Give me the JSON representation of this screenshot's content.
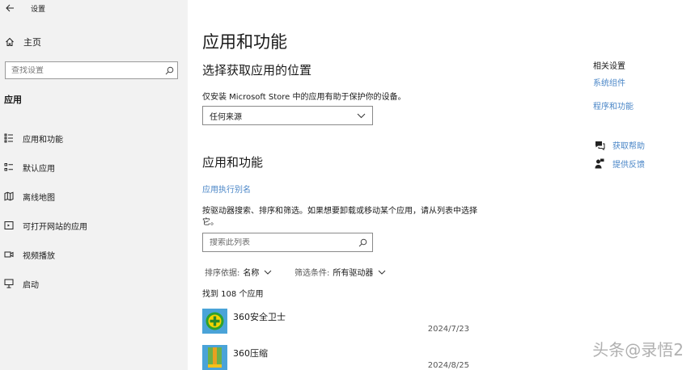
{
  "window": {
    "title": "设置"
  },
  "sidebar": {
    "home_label": "主页",
    "search_placeholder": "查找设置",
    "section_title": "应用",
    "items": [
      {
        "label": "应用和功能",
        "icon": "apps-list-icon"
      },
      {
        "label": "默认应用",
        "icon": "default-apps-icon"
      },
      {
        "label": "离线地图",
        "icon": "offline-map-icon"
      },
      {
        "label": "可打开网站的应用",
        "icon": "web-apps-icon"
      },
      {
        "label": "视频播放",
        "icon": "video-icon"
      },
      {
        "label": "启动",
        "icon": "startup-icon"
      }
    ]
  },
  "main": {
    "title": "应用和功能",
    "choose_heading": "选择获取应用的位置",
    "choose_desc": "仅安装 Microsoft Store 中的应用有助于保护你的设备。",
    "source_dropdown": {
      "selected": "任何来源"
    },
    "apps_heading": "应用和功能",
    "alias_link": "应用执行别名",
    "apps_desc": "按驱动器搜索、排序和筛选。如果想要卸载或移动某个应用，请从列表中选择它。",
    "search_placeholder": "搜索此列表",
    "sort": {
      "label": "排序依据:",
      "value": "名称"
    },
    "filter": {
      "label": "筛选条件:",
      "value": "所有驱动器"
    },
    "count_text": "找到 108 个应用",
    "apps": [
      {
        "name": "360安全卫士",
        "date": "2024/7/23"
      },
      {
        "name": "360压缩",
        "date": "2024/8/25"
      }
    ]
  },
  "related": {
    "title": "相关设置",
    "links": [
      "系统组件",
      "程序和功能"
    ],
    "help": [
      {
        "label": "获取帮助",
        "icon": "help-chat-icon"
      },
      {
        "label": "提供反馈",
        "icon": "feedback-icon"
      }
    ]
  },
  "watermark": "头条@录悟2",
  "colors": {
    "link": "#4a86c7",
    "sidebar_bg": "#f2f2f2"
  }
}
